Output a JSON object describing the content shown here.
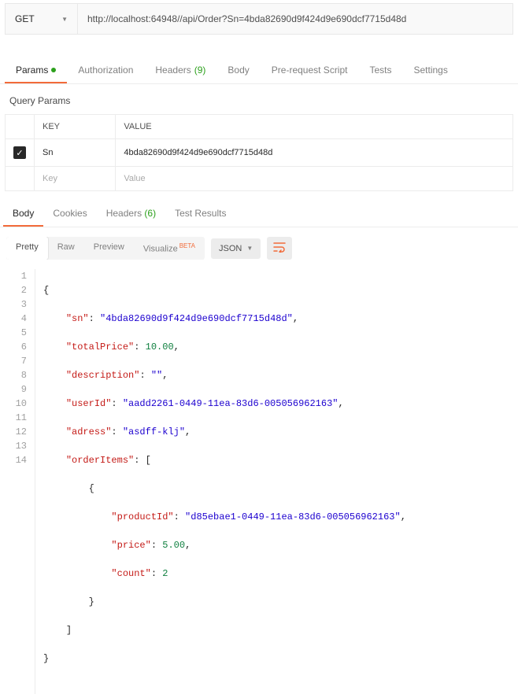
{
  "request": {
    "method": "GET",
    "url": "http://localhost:64948//api/Order?Sn=4bda82690d9f424d9e690dcf7715d48d"
  },
  "reqTabs": {
    "params": "Params",
    "auth": "Authorization",
    "headers": "Headers",
    "headersCount": "(9)",
    "body": "Body",
    "preReq": "Pre-request Script",
    "tests": "Tests",
    "settings": "Settings"
  },
  "querySection": "Query Params",
  "paramsHeader": {
    "key": "KEY",
    "value": "VALUE"
  },
  "params": {
    "row1": {
      "key": "Sn",
      "value": "4bda82690d9f424d9e690dcf7715d48d"
    },
    "placeholder": {
      "key": "Key",
      "value": "Value"
    }
  },
  "respTabs": {
    "body": "Body",
    "cookies": "Cookies",
    "headers": "Headers",
    "headersCount": "(6)",
    "testResults": "Test Results"
  },
  "views": {
    "pretty": "Pretty",
    "raw": "Raw",
    "preview": "Preview",
    "visualize": "Visualize",
    "beta": "BETA",
    "type": "JSON"
  },
  "json": {
    "sn": {
      "k": "\"sn\"",
      "v": "\"4bda82690d9f424d9e690dcf7715d48d\""
    },
    "totalPrice": {
      "k": "\"totalPrice\"",
      "v": "10.00"
    },
    "description": {
      "k": "\"description\"",
      "v": "\"\""
    },
    "userId": {
      "k": "\"userId\"",
      "v": "\"aadd2261-0449-11ea-83d6-005056962163\""
    },
    "adress": {
      "k": "\"adress\"",
      "v": "\"asdff-klj\""
    },
    "orderItems": {
      "k": "\"orderItems\""
    },
    "productId": {
      "k": "\"productId\"",
      "v": "\"d85ebae1-0449-11ea-83d6-005056962163\""
    },
    "price": {
      "k": "\"price\"",
      "v": "5.00"
    },
    "count": {
      "k": "\"count\"",
      "v": "2"
    }
  }
}
